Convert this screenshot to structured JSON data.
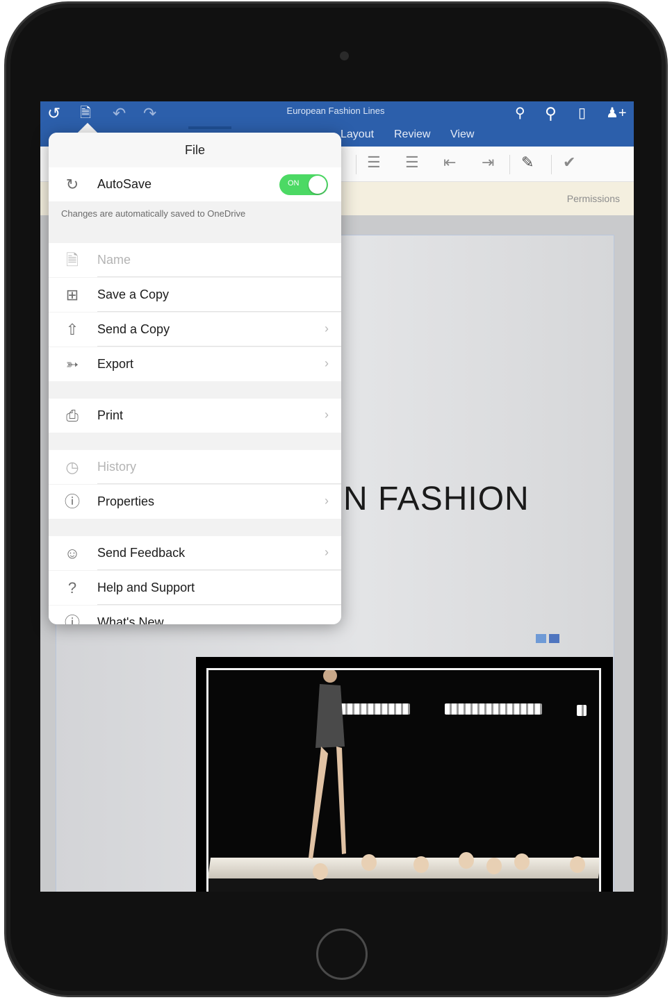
{
  "titlebar": {
    "doc_title": "European Fashion Lines",
    "icons": [
      "back-icon",
      "file-icon",
      "undo-icon",
      "redo-icon",
      "lightbulb-icon",
      "search-icon",
      "mobile-view-icon",
      "share-person-icon"
    ]
  },
  "ribbon": {
    "tabs": [
      "Layout",
      "Review",
      "View"
    ]
  },
  "infobar": {
    "permissions": "Permissions"
  },
  "document": {
    "heading": "N FASHION",
    "accent_colors": [
      "#6f9ad6",
      "#4f75bf"
    ]
  },
  "file_menu": {
    "title": "File",
    "autosave": {
      "label": "AutoSave",
      "toggle": "ON",
      "enabled": true
    },
    "note": "Changes are automatically saved to OneDrive",
    "items": [
      {
        "label": "Name",
        "icon": "document-icon",
        "disabled": true,
        "chevron": false
      },
      {
        "label": "Save a Copy",
        "icon": "save-copy-icon",
        "disabled": false,
        "chevron": false
      },
      {
        "label": "Send a Copy",
        "icon": "share-icon",
        "disabled": false,
        "chevron": true
      },
      {
        "label": "Export",
        "icon": "export-icon",
        "disabled": false,
        "chevron": true
      },
      {
        "label": "Print",
        "icon": "printer-icon",
        "disabled": false,
        "chevron": true
      },
      {
        "label": "History",
        "icon": "history-icon",
        "disabled": true,
        "chevron": false
      },
      {
        "label": "Properties",
        "icon": "info-icon",
        "disabled": false,
        "chevron": true
      },
      {
        "label": "Send Feedback",
        "icon": "feedback-icon",
        "disabled": false,
        "chevron": true
      },
      {
        "label": "Help and Support",
        "icon": "question-icon",
        "disabled": false,
        "chevron": false
      },
      {
        "label": "What's New",
        "icon": "info-icon",
        "disabled": false,
        "chevron": false
      }
    ]
  }
}
